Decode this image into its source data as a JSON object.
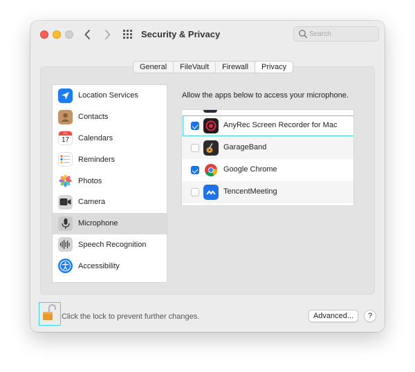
{
  "window": {
    "title": "Security & Privacy",
    "search_placeholder": "Search"
  },
  "tabs": [
    {
      "label": "General",
      "active": false
    },
    {
      "label": "FileVault",
      "active": false
    },
    {
      "label": "Firewall",
      "active": false
    },
    {
      "label": "Privacy",
      "active": true
    }
  ],
  "sidebar": {
    "items": [
      {
        "label": "Location Services",
        "icon": "location-arrow-icon",
        "selected": false
      },
      {
        "label": "Contacts",
        "icon": "contacts-icon",
        "selected": false
      },
      {
        "label": "Calendars",
        "icon": "calendar-icon",
        "selected": false,
        "icon_text": {
          "month": "JUL",
          "day": "17"
        }
      },
      {
        "label": "Reminders",
        "icon": "reminders-icon",
        "selected": false
      },
      {
        "label": "Photos",
        "icon": "photos-icon",
        "selected": false
      },
      {
        "label": "Camera",
        "icon": "camera-icon",
        "selected": false
      },
      {
        "label": "Microphone",
        "icon": "microphone-icon",
        "selected": true
      },
      {
        "label": "Speech Recognition",
        "icon": "speech-waveform-icon",
        "selected": false
      },
      {
        "label": "Accessibility",
        "icon": "accessibility-icon",
        "selected": false
      }
    ]
  },
  "main": {
    "heading": "Allow the apps below to access your microphone.",
    "apps": [
      {
        "label": "AnyRec Screen Recorder for Mac",
        "checked": true,
        "icon": "anyrec-icon",
        "highlighted": true
      },
      {
        "label": "GarageBand",
        "checked": false,
        "icon": "garageband-icon",
        "highlighted": false
      },
      {
        "label": "Google Chrome",
        "checked": true,
        "icon": "chrome-icon",
        "highlighted": false
      },
      {
        "label": "TencentMeeting",
        "checked": false,
        "icon": "tencent-meeting-icon",
        "highlighted": false
      }
    ]
  },
  "footer": {
    "lock_text": "Click the lock to prevent further changes.",
    "advanced_label": "Advanced...",
    "help_label": "?"
  },
  "colors": {
    "accent": "#1a76e8",
    "highlight": "#3fd5e6",
    "selected_row": "#dcdcdc"
  }
}
